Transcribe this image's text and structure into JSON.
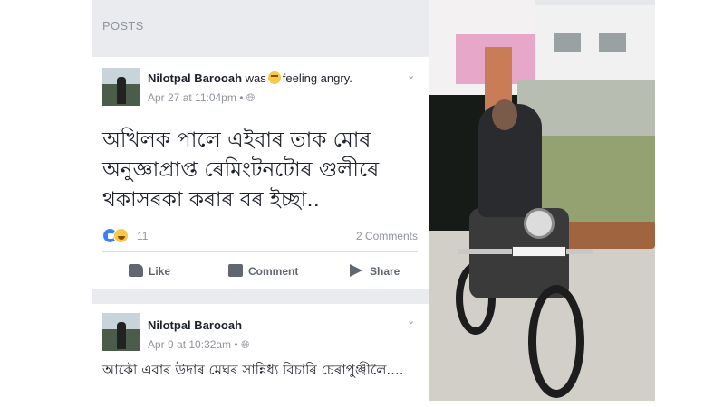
{
  "section_title": "POSTS",
  "posts": [
    {
      "author": "Nilotpal Barooah",
      "activity_prefix": "was",
      "feeling": "feeling angry.",
      "timestamp": "Apr 27 at 11:04pm",
      "privacy_icon": "public-globe-icon",
      "text": "অখিলক পালে এইবাৰ তাক মোৰ অনুজ্ঞাপ্ৰাপ্ত ৰেমিংটনটোৰ গুলীৰে থকাসৰকা কৰাৰ বৰ ইচ্ছা..",
      "reaction_count": "11",
      "comments_count": "2 Comments",
      "actions": {
        "like": "Like",
        "comment": "Comment",
        "share": "Share"
      }
    },
    {
      "author": "Nilotpal Barooah",
      "timestamp": "Apr 9 at 10:32am",
      "privacy_icon": "public-globe-icon",
      "text": "আকৌ এবাৰ উদাৰ মেঘৰ সান্নিধ্য বিচাৰি চেৰাপুঞ্জীলৈ...."
    }
  ],
  "colors": {
    "feed_bg": "#e9ebee",
    "card_bg": "#ffffff",
    "text_primary": "#1d2129",
    "text_muted": "#90949c",
    "action_gray": "#606770",
    "like_blue": "#3b82f6"
  }
}
